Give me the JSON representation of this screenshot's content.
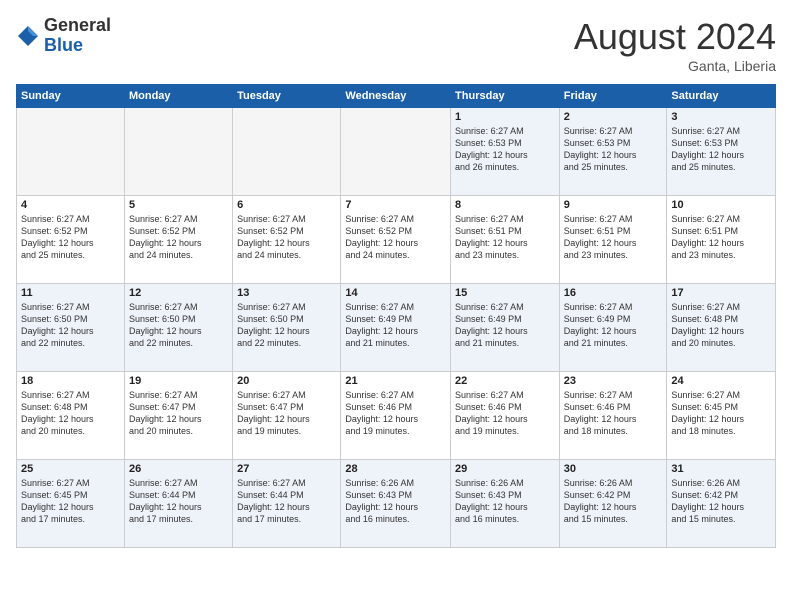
{
  "header": {
    "logo_general": "General",
    "logo_blue": "Blue",
    "month_title": "August 2024",
    "location": "Ganta, Liberia"
  },
  "weekdays": [
    "Sunday",
    "Monday",
    "Tuesday",
    "Wednesday",
    "Thursday",
    "Friday",
    "Saturday"
  ],
  "weeks": [
    {
      "row_class": "row-odd",
      "days": [
        {
          "num": "",
          "info": "",
          "empty": true
        },
        {
          "num": "",
          "info": "",
          "empty": true
        },
        {
          "num": "",
          "info": "",
          "empty": true
        },
        {
          "num": "",
          "info": "",
          "empty": true
        },
        {
          "num": "1",
          "info": "Sunrise: 6:27 AM\nSunset: 6:53 PM\nDaylight: 12 hours\nand 26 minutes.",
          "empty": false
        },
        {
          "num": "2",
          "info": "Sunrise: 6:27 AM\nSunset: 6:53 PM\nDaylight: 12 hours\nand 25 minutes.",
          "empty": false
        },
        {
          "num": "3",
          "info": "Sunrise: 6:27 AM\nSunset: 6:53 PM\nDaylight: 12 hours\nand 25 minutes.",
          "empty": false
        }
      ]
    },
    {
      "row_class": "row-even",
      "days": [
        {
          "num": "4",
          "info": "Sunrise: 6:27 AM\nSunset: 6:52 PM\nDaylight: 12 hours\nand 25 minutes.",
          "empty": false
        },
        {
          "num": "5",
          "info": "Sunrise: 6:27 AM\nSunset: 6:52 PM\nDaylight: 12 hours\nand 24 minutes.",
          "empty": false
        },
        {
          "num": "6",
          "info": "Sunrise: 6:27 AM\nSunset: 6:52 PM\nDaylight: 12 hours\nand 24 minutes.",
          "empty": false
        },
        {
          "num": "7",
          "info": "Sunrise: 6:27 AM\nSunset: 6:52 PM\nDaylight: 12 hours\nand 24 minutes.",
          "empty": false
        },
        {
          "num": "8",
          "info": "Sunrise: 6:27 AM\nSunset: 6:51 PM\nDaylight: 12 hours\nand 23 minutes.",
          "empty": false
        },
        {
          "num": "9",
          "info": "Sunrise: 6:27 AM\nSunset: 6:51 PM\nDaylight: 12 hours\nand 23 minutes.",
          "empty": false
        },
        {
          "num": "10",
          "info": "Sunrise: 6:27 AM\nSunset: 6:51 PM\nDaylight: 12 hours\nand 23 minutes.",
          "empty": false
        }
      ]
    },
    {
      "row_class": "row-odd",
      "days": [
        {
          "num": "11",
          "info": "Sunrise: 6:27 AM\nSunset: 6:50 PM\nDaylight: 12 hours\nand 22 minutes.",
          "empty": false
        },
        {
          "num": "12",
          "info": "Sunrise: 6:27 AM\nSunset: 6:50 PM\nDaylight: 12 hours\nand 22 minutes.",
          "empty": false
        },
        {
          "num": "13",
          "info": "Sunrise: 6:27 AM\nSunset: 6:50 PM\nDaylight: 12 hours\nand 22 minutes.",
          "empty": false
        },
        {
          "num": "14",
          "info": "Sunrise: 6:27 AM\nSunset: 6:49 PM\nDaylight: 12 hours\nand 21 minutes.",
          "empty": false
        },
        {
          "num": "15",
          "info": "Sunrise: 6:27 AM\nSunset: 6:49 PM\nDaylight: 12 hours\nand 21 minutes.",
          "empty": false
        },
        {
          "num": "16",
          "info": "Sunrise: 6:27 AM\nSunset: 6:49 PM\nDaylight: 12 hours\nand 21 minutes.",
          "empty": false
        },
        {
          "num": "17",
          "info": "Sunrise: 6:27 AM\nSunset: 6:48 PM\nDaylight: 12 hours\nand 20 minutes.",
          "empty": false
        }
      ]
    },
    {
      "row_class": "row-even",
      "days": [
        {
          "num": "18",
          "info": "Sunrise: 6:27 AM\nSunset: 6:48 PM\nDaylight: 12 hours\nand 20 minutes.",
          "empty": false
        },
        {
          "num": "19",
          "info": "Sunrise: 6:27 AM\nSunset: 6:47 PM\nDaylight: 12 hours\nand 20 minutes.",
          "empty": false
        },
        {
          "num": "20",
          "info": "Sunrise: 6:27 AM\nSunset: 6:47 PM\nDaylight: 12 hours\nand 19 minutes.",
          "empty": false
        },
        {
          "num": "21",
          "info": "Sunrise: 6:27 AM\nSunset: 6:46 PM\nDaylight: 12 hours\nand 19 minutes.",
          "empty": false
        },
        {
          "num": "22",
          "info": "Sunrise: 6:27 AM\nSunset: 6:46 PM\nDaylight: 12 hours\nand 19 minutes.",
          "empty": false
        },
        {
          "num": "23",
          "info": "Sunrise: 6:27 AM\nSunset: 6:46 PM\nDaylight: 12 hours\nand 18 minutes.",
          "empty": false
        },
        {
          "num": "24",
          "info": "Sunrise: 6:27 AM\nSunset: 6:45 PM\nDaylight: 12 hours\nand 18 minutes.",
          "empty": false
        }
      ]
    },
    {
      "row_class": "row-odd",
      "days": [
        {
          "num": "25",
          "info": "Sunrise: 6:27 AM\nSunset: 6:45 PM\nDaylight: 12 hours\nand 17 minutes.",
          "empty": false
        },
        {
          "num": "26",
          "info": "Sunrise: 6:27 AM\nSunset: 6:44 PM\nDaylight: 12 hours\nand 17 minutes.",
          "empty": false
        },
        {
          "num": "27",
          "info": "Sunrise: 6:27 AM\nSunset: 6:44 PM\nDaylight: 12 hours\nand 17 minutes.",
          "empty": false
        },
        {
          "num": "28",
          "info": "Sunrise: 6:26 AM\nSunset: 6:43 PM\nDaylight: 12 hours\nand 16 minutes.",
          "empty": false
        },
        {
          "num": "29",
          "info": "Sunrise: 6:26 AM\nSunset: 6:43 PM\nDaylight: 12 hours\nand 16 minutes.",
          "empty": false
        },
        {
          "num": "30",
          "info": "Sunrise: 6:26 AM\nSunset: 6:42 PM\nDaylight: 12 hours\nand 15 minutes.",
          "empty": false
        },
        {
          "num": "31",
          "info": "Sunrise: 6:26 AM\nSunset: 6:42 PM\nDaylight: 12 hours\nand 15 minutes.",
          "empty": false
        }
      ]
    }
  ]
}
